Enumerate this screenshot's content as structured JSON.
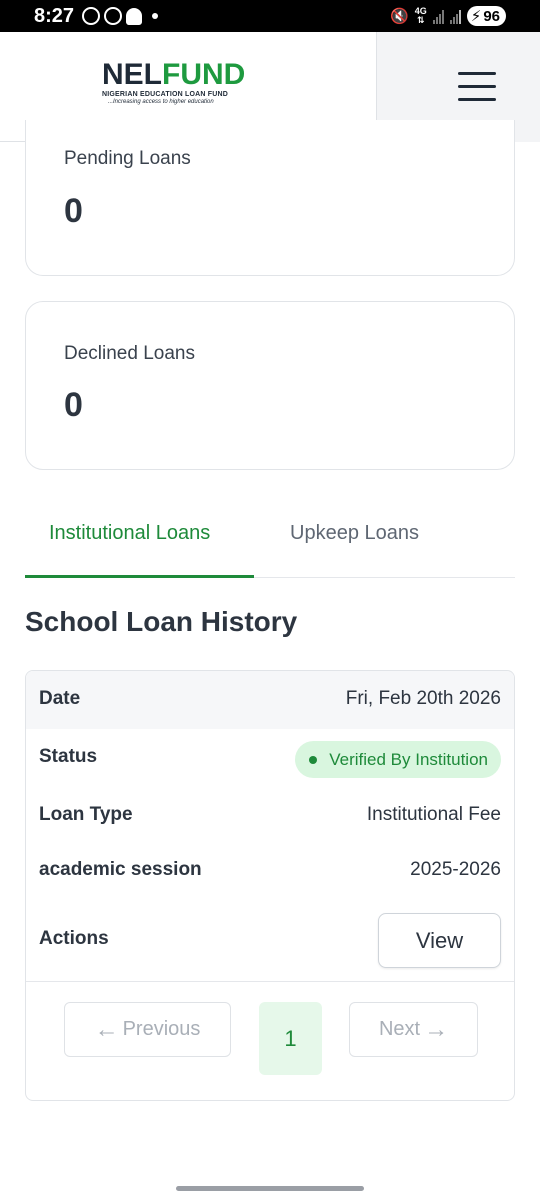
{
  "status_bar": {
    "time": "8:27",
    "network": "4G",
    "battery": "96"
  },
  "header": {
    "logo": {
      "word_a": "NEL",
      "word_b": "FUND",
      "subtitle": "NIGERIAN EDUCATION LOAN FUND",
      "tagline": "...Increasing access to higher education"
    },
    "menu_icon": "hamburger-menu-icon"
  },
  "cards": {
    "pending": {
      "label": "Pending Loans",
      "value": "0"
    },
    "declined": {
      "label": "Declined Loans",
      "value": "0"
    }
  },
  "tabs": [
    {
      "label": "Institutional Loans",
      "active": true
    },
    {
      "label": "Upkeep Loans",
      "active": false
    }
  ],
  "section_title": "School Loan History",
  "history": {
    "date_label": "Date",
    "date_value": "Fri, Feb 20th 2026",
    "status_label": "Status",
    "status_value": "Verified By Institution",
    "loan_type_label": "Loan Type",
    "loan_type_value": "Institutional Fee",
    "session_label": "academic session",
    "session_value": "2025-2026",
    "actions_label": "Actions",
    "view_button": "View"
  },
  "pagination": {
    "previous": "Previous",
    "next": "Next",
    "current_page": "1"
  },
  "colors": {
    "brand_green": "#1e8a3a",
    "badge_bg": "#d9f6df",
    "text_dark": "#2d3540"
  }
}
